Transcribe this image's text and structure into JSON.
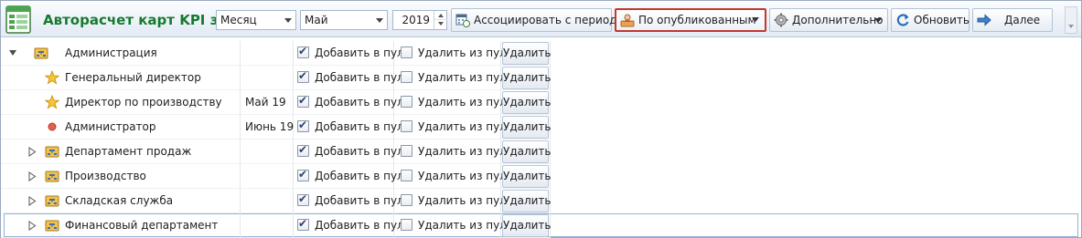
{
  "toolbar": {
    "title": "Авторасчет карт KPI за",
    "period_type": "Месяц",
    "month": "Май",
    "year": "2019",
    "associate_label": "Ассоциировать с периодом",
    "filter_label": "По опубликованным",
    "more_label": "Дополнительно",
    "refresh_label": "Обновить",
    "next_label": "Далее"
  },
  "rows": [
    {
      "name": "Администрация",
      "date": "",
      "add_label": "Добавить в пул",
      "add_checked": true,
      "remove_label": "Удалить из пула",
      "remove_checked": false,
      "delete_label": "Удалить",
      "icon": "org-unit-icon",
      "expander": "open"
    },
    {
      "name": "Генеральный директор",
      "date": "",
      "add_label": "Добавить в пул",
      "add_checked": true,
      "remove_label": "Удалить из пула",
      "remove_checked": false,
      "delete_label": "Удалить",
      "icon": "star-icon",
      "expander": "none"
    },
    {
      "name": "Директор по производству",
      "date": "Май 19",
      "add_label": "Добавить в пул",
      "add_checked": true,
      "remove_label": "Удалить из пула",
      "remove_checked": false,
      "delete_label": "Удалить",
      "icon": "star-icon",
      "expander": "none"
    },
    {
      "name": "Администратор",
      "date": "Июнь 19",
      "add_label": "Добавить в пул",
      "add_checked": true,
      "remove_label": "Удалить из пула",
      "remove_checked": false,
      "delete_label": "Удалить",
      "icon": "dot-icon",
      "expander": "none"
    },
    {
      "name": "Департамент продаж",
      "date": "",
      "add_label": "Добавить в пул",
      "add_checked": true,
      "remove_label": "Удалить из пула",
      "remove_checked": false,
      "delete_label": "Удалить",
      "icon": "org-unit-icon",
      "expander": "closed"
    },
    {
      "name": "Производство",
      "date": "",
      "add_label": "Добавить в пул",
      "add_checked": true,
      "remove_label": "Удалить из пула",
      "remove_checked": false,
      "delete_label": "Удалить",
      "icon": "org-unit-icon",
      "expander": "closed"
    },
    {
      "name": "Складская служба",
      "date": "",
      "add_label": "Добавить в пул",
      "add_checked": true,
      "remove_label": "Удалить из пула",
      "remove_checked": false,
      "delete_label": "Удалить",
      "icon": "org-unit-icon",
      "expander": "closed"
    },
    {
      "name": "Финансовый департамент",
      "date": "",
      "add_label": "Добавить в пул",
      "add_checked": true,
      "remove_label": "Удалить из пула",
      "remove_checked": false,
      "delete_label": "Удалить",
      "icon": "org-unit-icon",
      "expander": "closed"
    }
  ],
  "colors": {
    "title_green": "#157a2e",
    "highlight_red": "#c0392b",
    "selection_border": "#8fb3d6"
  }
}
